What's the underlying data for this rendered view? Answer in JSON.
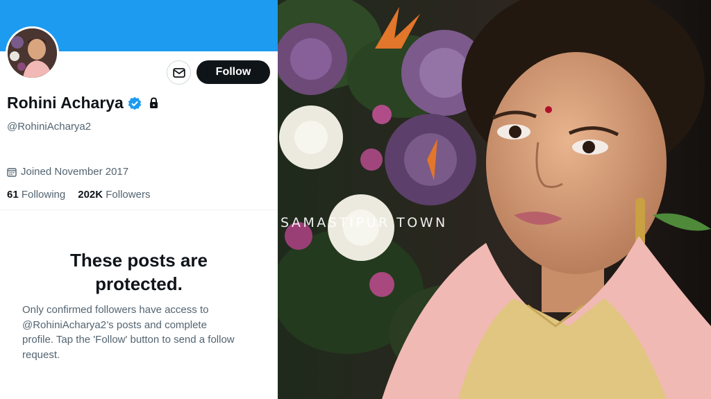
{
  "profile": {
    "display_name": "Rohini Acharya",
    "handle": "@RohiniAcharya2",
    "joined": "Joined November 2017",
    "following_count": "61",
    "following_label": "Following",
    "followers_count": "202K",
    "followers_label": "Followers",
    "follow_button": "Follow",
    "verified_badge_icon": "verified-badge-icon",
    "protected_icon": "lock-icon",
    "message_icon": "envelope-icon",
    "calendar_icon": "calendar-icon"
  },
  "protected_notice": {
    "title_line1": "These posts are",
    "title_line2": "protected.",
    "body_line1": "Only confirmed followers have access to",
    "body_line2": "@RohiniAcharya2’s posts and complete",
    "body_line3": "profile. Tap the 'Follow' button to send a follow",
    "body_line4": "request."
  },
  "photo": {
    "watermark": "SAMASTIPUR TOWN"
  },
  "colors": {
    "banner": "#1d9bf0",
    "follow_button_bg": "#0f1419",
    "secondary_text": "#536471",
    "verified": "#1d9bf0"
  }
}
